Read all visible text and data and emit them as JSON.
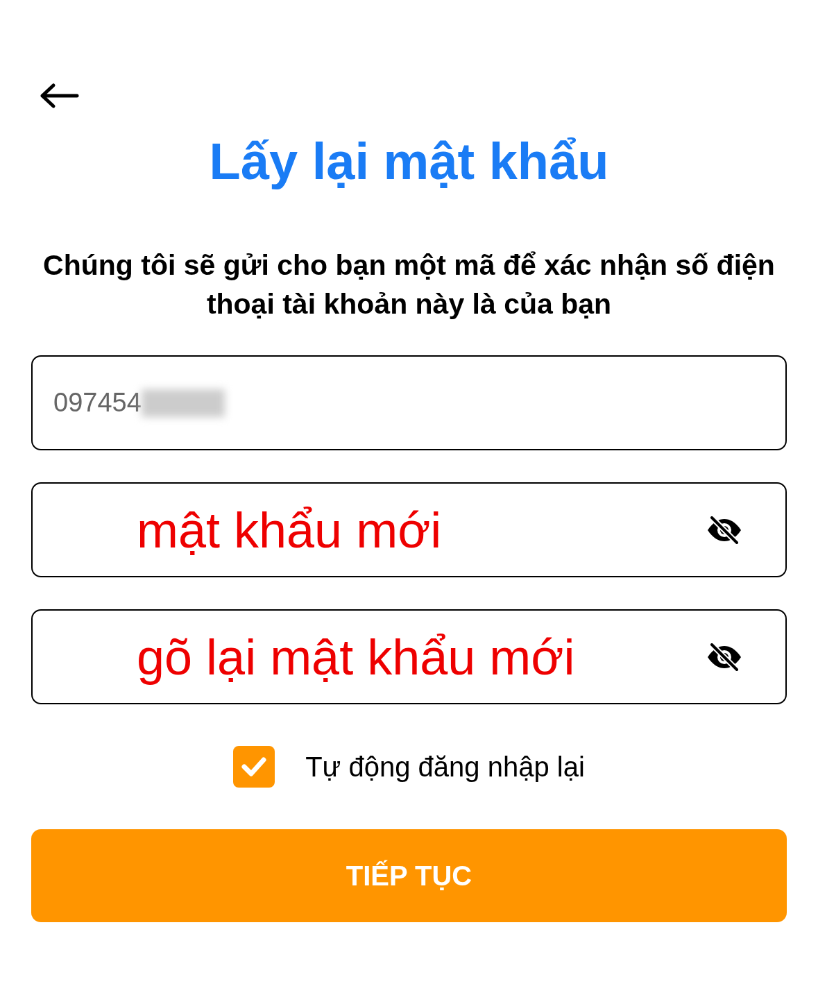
{
  "title": "Lấy lại mật khẩu",
  "subtitle": "Chúng tôi sẽ gửi cho bạn một mã để xác nhận số điện thoại tài khoản này là của bạn",
  "fields": [
    {
      "kind": "phone",
      "value": "097454",
      "redacted": true
    },
    {
      "kind": "password",
      "value": "mật khẩu mới",
      "password_visible": false
    },
    {
      "kind": "password",
      "value": "gõ lại mật khẩu mới",
      "password_visible": false
    }
  ],
  "auto_login": {
    "label": "Tự động đăng nhập lại",
    "checked": true
  },
  "submit": {
    "label": "TIẾP TỤC"
  }
}
